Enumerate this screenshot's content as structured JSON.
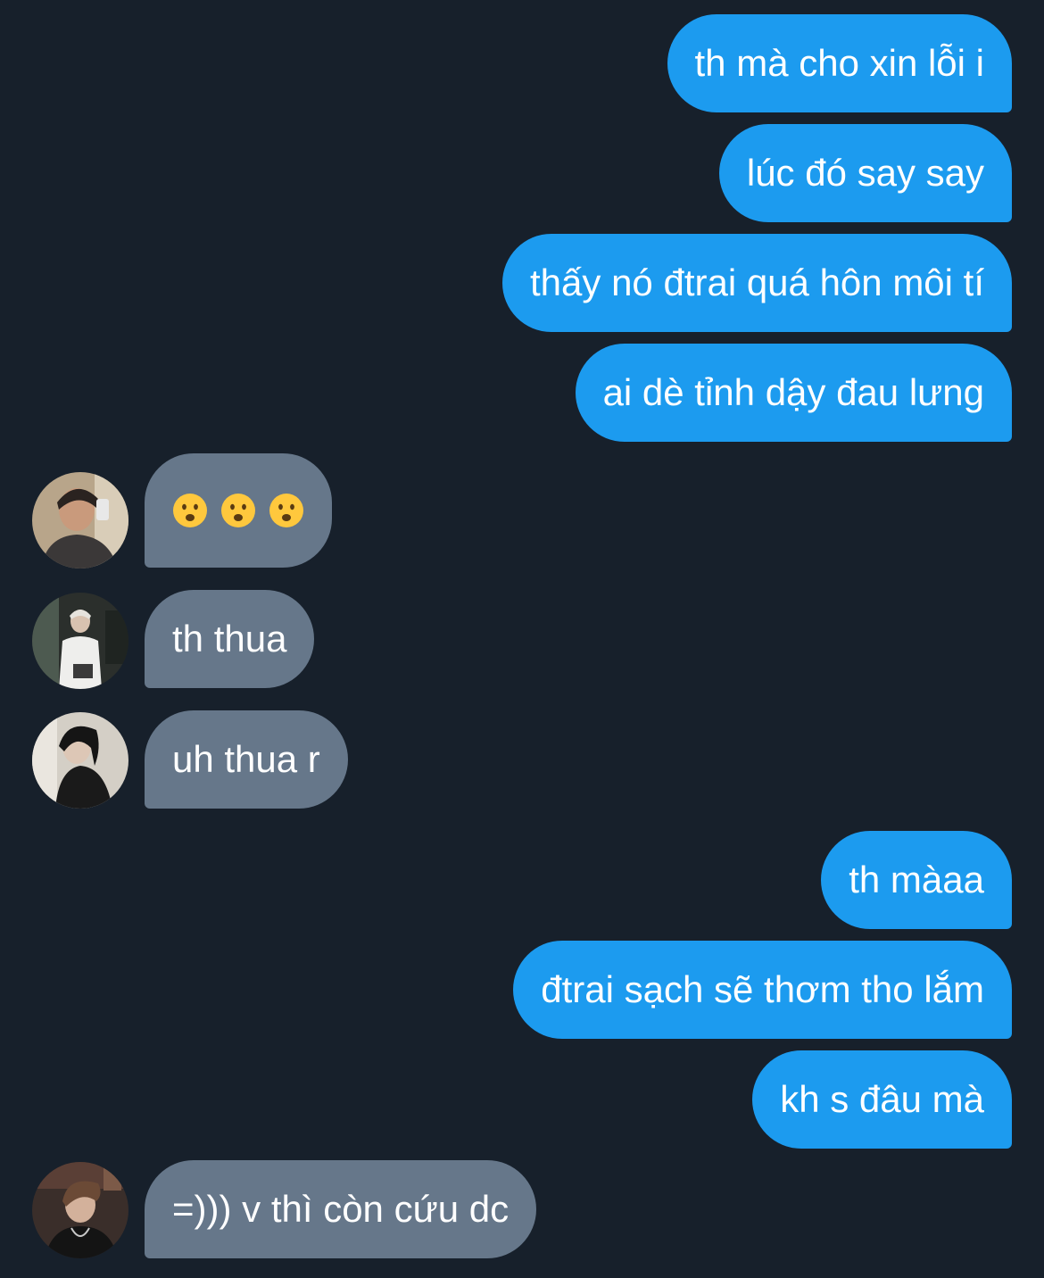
{
  "colors": {
    "background": "#17202b",
    "outgoing_bubble": "#1c9bef",
    "incoming_bubble": "#66778a",
    "text": "#ffffff"
  },
  "messages": [
    {
      "direction": "outgoing",
      "text": "th mà cho xin lỗi i"
    },
    {
      "direction": "outgoing",
      "text": "lúc đó say say"
    },
    {
      "direction": "outgoing",
      "text": "thấy nó đtrai quá hôn môi tí"
    },
    {
      "direction": "outgoing",
      "text": "ai dè tỉnh dậy đau lưng"
    },
    {
      "direction": "incoming",
      "emoji": [
        "frowning-face-with-open-mouth",
        "frowning-face-with-open-mouth",
        "frowning-face-with-open-mouth"
      ],
      "avatar": "user-avatar-1"
    },
    {
      "direction": "incoming",
      "text": "th thua",
      "avatar": "user-avatar-2"
    },
    {
      "direction": "incoming",
      "text": "uh thua r",
      "avatar": "user-avatar-3"
    },
    {
      "direction": "outgoing",
      "text": "th màaa"
    },
    {
      "direction": "outgoing",
      "text": "đtrai sạch sẽ thơm tho lắm"
    },
    {
      "direction": "outgoing",
      "text": "kh s đâu mà"
    },
    {
      "direction": "incoming",
      "text": "=))) v thì còn cứu dc",
      "avatar": "user-avatar-4"
    }
  ]
}
